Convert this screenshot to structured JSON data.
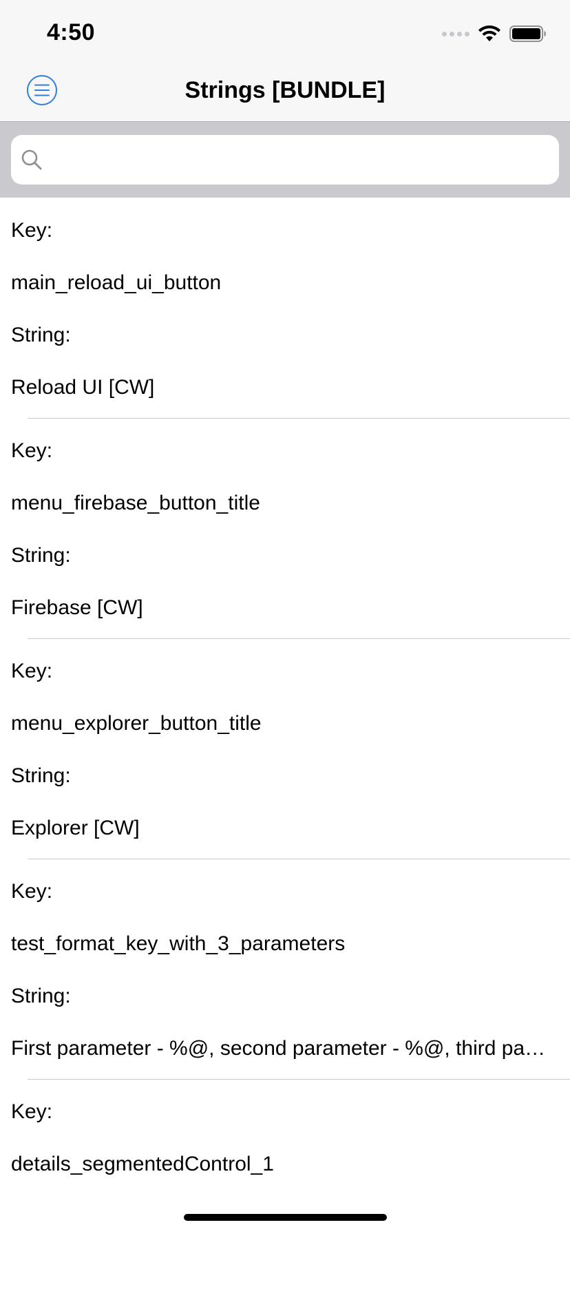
{
  "status_bar": {
    "time": "4:50"
  },
  "nav": {
    "title": "Strings [BUNDLE]",
    "menu_icon": "list-icon",
    "accent_color": "#2f7fd6"
  },
  "search": {
    "value": "",
    "placeholder": ""
  },
  "rows": [
    {
      "key_label": "Key:",
      "key": "main_reload_ui_button",
      "string_label": "String:",
      "string": "Reload UI [CW]"
    },
    {
      "key_label": "Key:",
      "key": "menu_firebase_button_title",
      "string_label": "String:",
      "string": "Firebase [CW]"
    },
    {
      "key_label": "Key:",
      "key": "menu_explorer_button_title",
      "string_label": "String:",
      "string": "Explorer [CW]"
    },
    {
      "key_label": "Key:",
      "key": "test_format_key_with_3_parameters",
      "string_label": "String:",
      "string": "First parameter - %@, second parameter - %@, third parameter - %@"
    },
    {
      "key_label": "Key:",
      "key": "details_segmentedControl_1",
      "string_label": "",
      "string": ""
    }
  ]
}
